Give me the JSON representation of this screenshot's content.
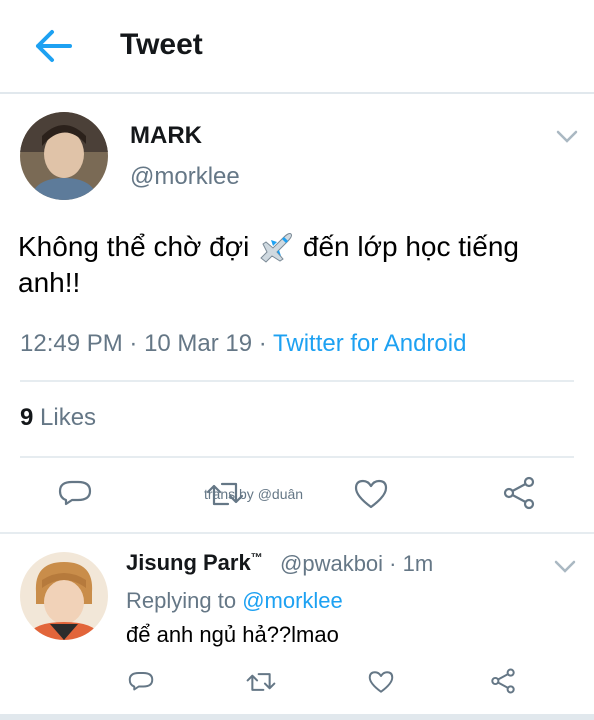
{
  "header": {
    "title": "Tweet",
    "back_icon": "arrow-left-icon"
  },
  "colors": {
    "accent": "#1da1f2",
    "secondary": "#657786",
    "divider": "#e6ecf0"
  },
  "tweet": {
    "author_name": "MARK",
    "author_handle": "@morklee",
    "text_before": "Không thể chờ đợi",
    "emoji": "airplane-icon",
    "text_after": " đến lớp học tiếng anh!!",
    "time": "12:49 PM",
    "date": "10 Mar 19",
    "source": "Twitter for Android",
    "likes_count": "9",
    "likes_label": "Likes",
    "watermark": "trans by @duân"
  },
  "reply": {
    "author_name": "Jisung Park",
    "tm": "™",
    "author_handle": "@pwakboi",
    "age": "1m",
    "replying_prefix": "Replying to ",
    "replying_handle": "@morklee",
    "text": "để anh ngủ hả??lmao"
  },
  "actions": [
    "reply-icon",
    "retweet-icon",
    "like-icon",
    "share-icon"
  ]
}
